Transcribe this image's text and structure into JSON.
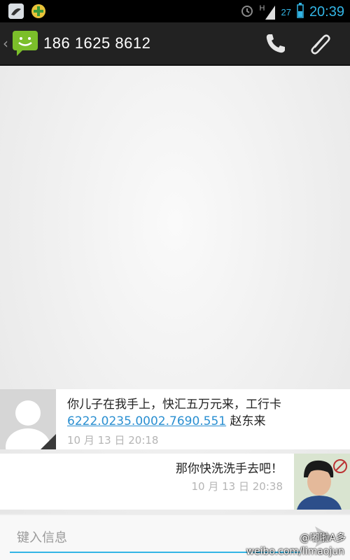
{
  "status_bar": {
    "time": "20:39",
    "signal_label": "H",
    "battery_level": "27",
    "icons": [
      "weather-icon",
      "app-notification-icon",
      "alarm-icon",
      "signal-icon",
      "battery-icon"
    ]
  },
  "action_bar": {
    "title": "186 1625 8612",
    "icons": [
      "back-chevron-icon",
      "messaging-app-icon",
      "phone-call-icon",
      "attach-paperclip-icon"
    ]
  },
  "messages": [
    {
      "direction": "incoming",
      "text_before_link": "你儿子在我手上，快汇五万元来，工行卡",
      "link": "6222.0235.0002.7690.551",
      "text_after_link": " 赵东来",
      "time": "10 月 13 日 20:18"
    },
    {
      "direction": "outgoing",
      "text": "那你快洗洗手去吧！",
      "time": "10 月 13 日 20:38"
    }
  ],
  "composer": {
    "placeholder": "键入信息"
  },
  "watermark": {
    "handle": "@嘟啦A多",
    "url": "weibo.com/limaojun"
  },
  "colors": {
    "accent": "#33b5e5",
    "link": "#2a8fd1",
    "action_bar": "#222222",
    "status_bar": "#000000"
  }
}
